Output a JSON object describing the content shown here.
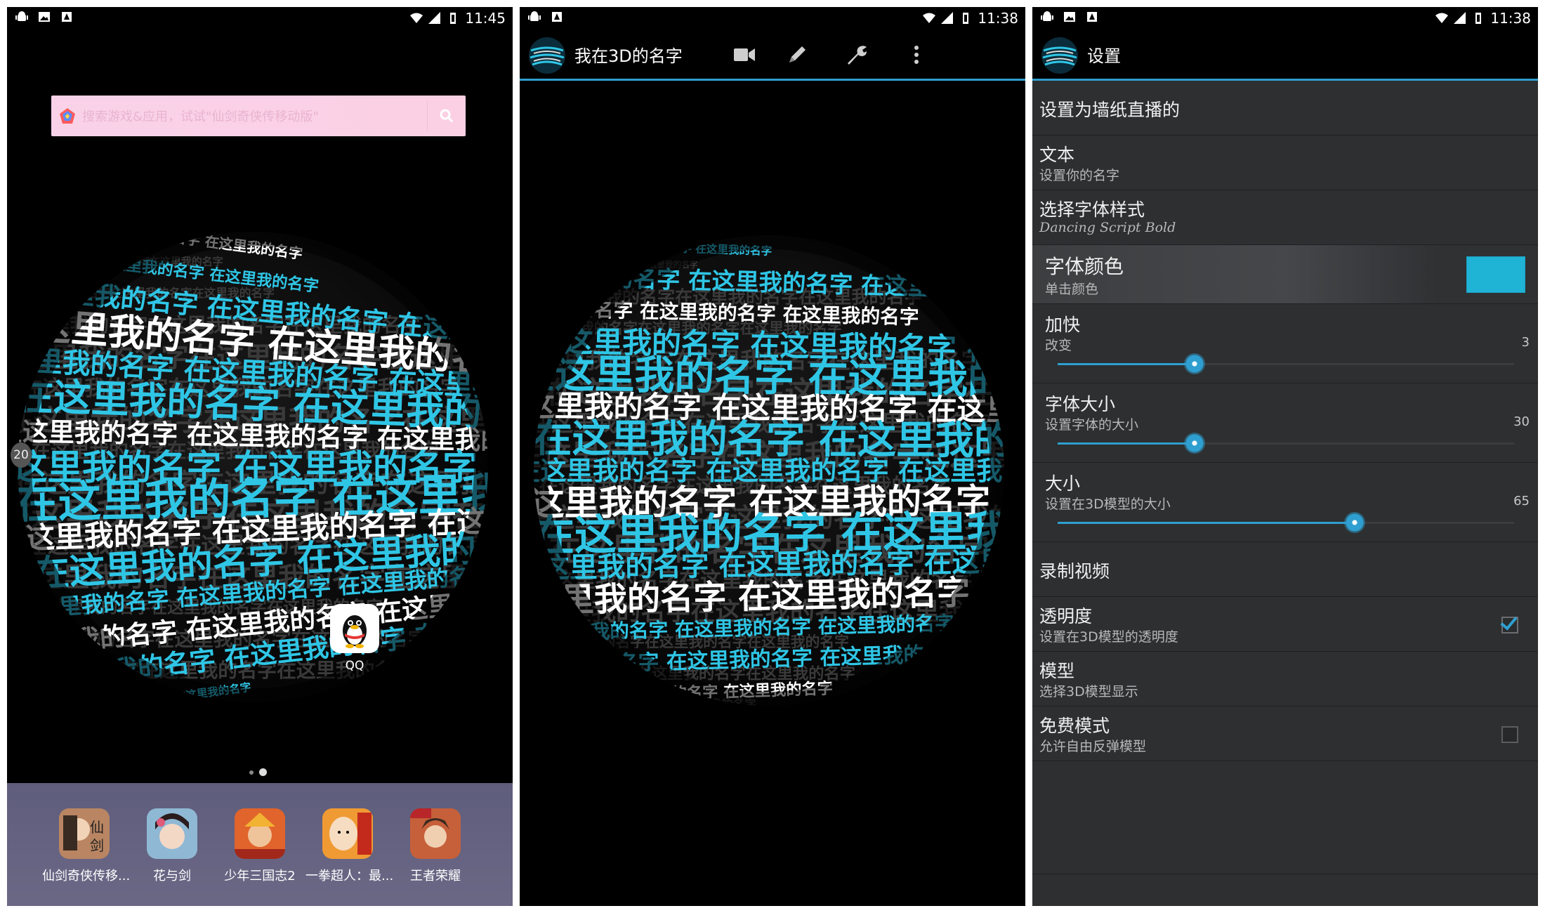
{
  "phone1": {
    "status": {
      "time": "11:45"
    },
    "search": {
      "placeholder": "搜索游戏&应用，试试\"仙剑奇侠传移动版\""
    },
    "edge_badge": "20",
    "qq_label": "QQ",
    "dock": [
      {
        "label": "仙剑奇侠传移...",
        "icon": "xianjian-icon",
        "color": "#a8704a"
      },
      {
        "label": "花与剑",
        "icon": "huayujian-icon",
        "color": "#c9a08a"
      },
      {
        "label": "少年三国志2",
        "icon": "shaonian-sanguozhi-icon",
        "color": "#d2562a"
      },
      {
        "label": "一拳超人：最...",
        "icon": "onepunch-man-icon",
        "color": "#e08a32"
      },
      {
        "label": "王者荣耀",
        "icon": "wangzhe-rongyao-icon",
        "color": "#c25a30"
      }
    ]
  },
  "phone2": {
    "status": {
      "time": "11:38"
    },
    "title": "我在3D的名字",
    "actions": [
      "video-camera-icon",
      "pencil-icon",
      "wrench-icon",
      "overflow-menu-icon"
    ]
  },
  "phone3": {
    "status": {
      "time": "11:38"
    },
    "title": "设置",
    "prefs": {
      "live_wallpaper": {
        "title": "设置为墙纸直播的"
      },
      "text": {
        "title": "文本",
        "summary": "设置你的名字"
      },
      "font_style": {
        "title": "选择字体样式",
        "summary": "Dancing Script Bold"
      },
      "font_color": {
        "title": "字体颜色",
        "summary": "单击颜色",
        "color": "#1fb3d6"
      },
      "speed": {
        "title": "加快",
        "summary": "改变",
        "value": "3",
        "fraction": 0.3
      },
      "font_size": {
        "title": "字体大小",
        "summary": "设置字体的大小",
        "value": "30",
        "fraction": 0.3
      },
      "size": {
        "title": "大小",
        "summary": "设置在3D模型的大小",
        "value": "65",
        "fraction": 0.65
      },
      "record_video": {
        "title": "录制视频"
      },
      "transparency": {
        "title": "透明度",
        "summary": "设置在3D模型的透明度",
        "checked": true
      },
      "model": {
        "title": "模型",
        "summary": "选择3D模型显示"
      },
      "free_mode": {
        "title": "免费模式",
        "summary": "允许自由反弹模型",
        "checked": false
      }
    }
  },
  "sphere": {
    "phrase": "在这里我的名字",
    "accent": "#2fc6e6"
  }
}
